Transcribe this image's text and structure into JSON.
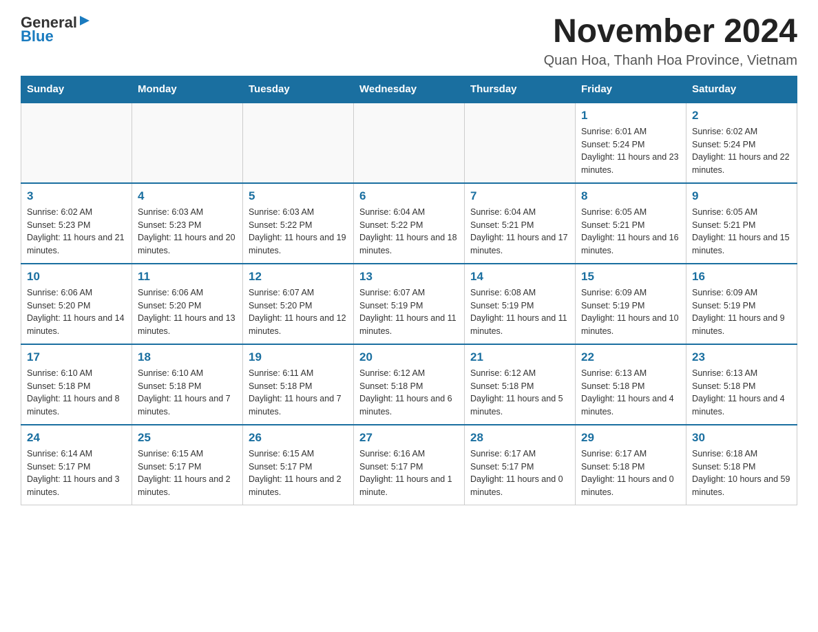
{
  "logo": {
    "general": "General",
    "blue": "Blue"
  },
  "header": {
    "title": "November 2024",
    "subtitle": "Quan Hoa, Thanh Hoa Province, Vietnam"
  },
  "days_of_week": [
    "Sunday",
    "Monday",
    "Tuesday",
    "Wednesday",
    "Thursday",
    "Friday",
    "Saturday"
  ],
  "weeks": [
    [
      {
        "day": "",
        "info": ""
      },
      {
        "day": "",
        "info": ""
      },
      {
        "day": "",
        "info": ""
      },
      {
        "day": "",
        "info": ""
      },
      {
        "day": "",
        "info": ""
      },
      {
        "day": "1",
        "info": "Sunrise: 6:01 AM\nSunset: 5:24 PM\nDaylight: 11 hours and 23 minutes."
      },
      {
        "day": "2",
        "info": "Sunrise: 6:02 AM\nSunset: 5:24 PM\nDaylight: 11 hours and 22 minutes."
      }
    ],
    [
      {
        "day": "3",
        "info": "Sunrise: 6:02 AM\nSunset: 5:23 PM\nDaylight: 11 hours and 21 minutes."
      },
      {
        "day": "4",
        "info": "Sunrise: 6:03 AM\nSunset: 5:23 PM\nDaylight: 11 hours and 20 minutes."
      },
      {
        "day": "5",
        "info": "Sunrise: 6:03 AM\nSunset: 5:22 PM\nDaylight: 11 hours and 19 minutes."
      },
      {
        "day": "6",
        "info": "Sunrise: 6:04 AM\nSunset: 5:22 PM\nDaylight: 11 hours and 18 minutes."
      },
      {
        "day": "7",
        "info": "Sunrise: 6:04 AM\nSunset: 5:21 PM\nDaylight: 11 hours and 17 minutes."
      },
      {
        "day": "8",
        "info": "Sunrise: 6:05 AM\nSunset: 5:21 PM\nDaylight: 11 hours and 16 minutes."
      },
      {
        "day": "9",
        "info": "Sunrise: 6:05 AM\nSunset: 5:21 PM\nDaylight: 11 hours and 15 minutes."
      }
    ],
    [
      {
        "day": "10",
        "info": "Sunrise: 6:06 AM\nSunset: 5:20 PM\nDaylight: 11 hours and 14 minutes."
      },
      {
        "day": "11",
        "info": "Sunrise: 6:06 AM\nSunset: 5:20 PM\nDaylight: 11 hours and 13 minutes."
      },
      {
        "day": "12",
        "info": "Sunrise: 6:07 AM\nSunset: 5:20 PM\nDaylight: 11 hours and 12 minutes."
      },
      {
        "day": "13",
        "info": "Sunrise: 6:07 AM\nSunset: 5:19 PM\nDaylight: 11 hours and 11 minutes."
      },
      {
        "day": "14",
        "info": "Sunrise: 6:08 AM\nSunset: 5:19 PM\nDaylight: 11 hours and 11 minutes."
      },
      {
        "day": "15",
        "info": "Sunrise: 6:09 AM\nSunset: 5:19 PM\nDaylight: 11 hours and 10 minutes."
      },
      {
        "day": "16",
        "info": "Sunrise: 6:09 AM\nSunset: 5:19 PM\nDaylight: 11 hours and 9 minutes."
      }
    ],
    [
      {
        "day": "17",
        "info": "Sunrise: 6:10 AM\nSunset: 5:18 PM\nDaylight: 11 hours and 8 minutes."
      },
      {
        "day": "18",
        "info": "Sunrise: 6:10 AM\nSunset: 5:18 PM\nDaylight: 11 hours and 7 minutes."
      },
      {
        "day": "19",
        "info": "Sunrise: 6:11 AM\nSunset: 5:18 PM\nDaylight: 11 hours and 7 minutes."
      },
      {
        "day": "20",
        "info": "Sunrise: 6:12 AM\nSunset: 5:18 PM\nDaylight: 11 hours and 6 minutes."
      },
      {
        "day": "21",
        "info": "Sunrise: 6:12 AM\nSunset: 5:18 PM\nDaylight: 11 hours and 5 minutes."
      },
      {
        "day": "22",
        "info": "Sunrise: 6:13 AM\nSunset: 5:18 PM\nDaylight: 11 hours and 4 minutes."
      },
      {
        "day": "23",
        "info": "Sunrise: 6:13 AM\nSunset: 5:18 PM\nDaylight: 11 hours and 4 minutes."
      }
    ],
    [
      {
        "day": "24",
        "info": "Sunrise: 6:14 AM\nSunset: 5:17 PM\nDaylight: 11 hours and 3 minutes."
      },
      {
        "day": "25",
        "info": "Sunrise: 6:15 AM\nSunset: 5:17 PM\nDaylight: 11 hours and 2 minutes."
      },
      {
        "day": "26",
        "info": "Sunrise: 6:15 AM\nSunset: 5:17 PM\nDaylight: 11 hours and 2 minutes."
      },
      {
        "day": "27",
        "info": "Sunrise: 6:16 AM\nSunset: 5:17 PM\nDaylight: 11 hours and 1 minute."
      },
      {
        "day": "28",
        "info": "Sunrise: 6:17 AM\nSunset: 5:17 PM\nDaylight: 11 hours and 0 minutes."
      },
      {
        "day": "29",
        "info": "Sunrise: 6:17 AM\nSunset: 5:18 PM\nDaylight: 11 hours and 0 minutes."
      },
      {
        "day": "30",
        "info": "Sunrise: 6:18 AM\nSunset: 5:18 PM\nDaylight: 10 hours and 59 minutes."
      }
    ]
  ]
}
